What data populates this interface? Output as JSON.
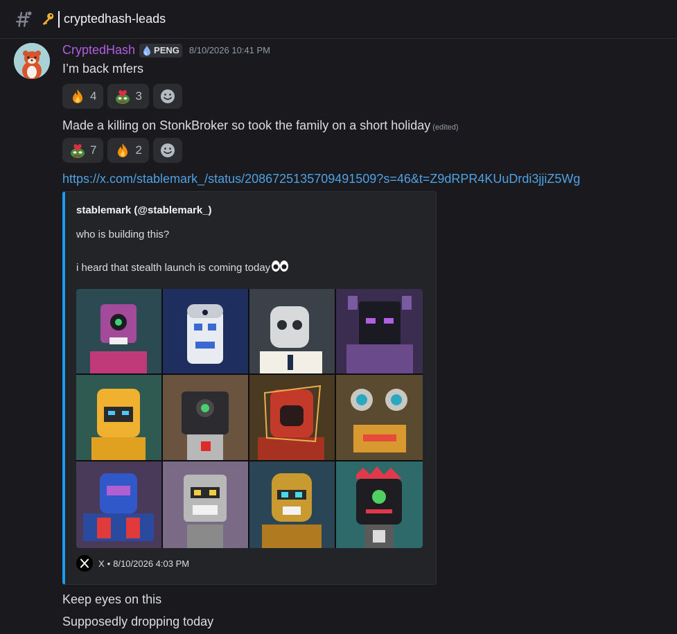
{
  "channel": {
    "name": "cryptedhash-leads",
    "hash_icon": "hash-icon",
    "key_icon": "key-icon"
  },
  "message": {
    "author": "CryptedHash",
    "author_color": "#b05ee0",
    "tag": "PENG",
    "timestamp": "8/10/2026 10:41 PM",
    "lines": [
      "I’m back mfers",
      "Made a killing on StonkBroker so took the family on a short holiday",
      "Keep eyes on this",
      "Supposedly dropping today"
    ],
    "edited_label": "(edited)",
    "link": "https://x.com/stablemark_/status/2086725135709491509?s=46&t=Z9dRPR4KUuDrdi3jjiZ5Wg",
    "reactions_1": [
      {
        "emoji": "fire-emoji",
        "count": "4"
      },
      {
        "emoji": "pepe-love-emoji",
        "count": "3"
      }
    ],
    "reactions_2": [
      {
        "emoji": "pepe-love-emoji",
        "count": "7"
      },
      {
        "emoji": "fire-emoji",
        "count": "2"
      }
    ],
    "add_reaction_icon": "smile-icon"
  },
  "embed": {
    "accent": "#1d9bf0",
    "author": "stablemark (@stablemark_)",
    "text_1": "who is building this?",
    "text_2": "i heard that stealth launch is coming today",
    "eyes_icon": "eyes-emoji",
    "image": "robot-nft-grid",
    "footer_source": "X",
    "footer_time": "8/10/2026 4:03 PM"
  }
}
